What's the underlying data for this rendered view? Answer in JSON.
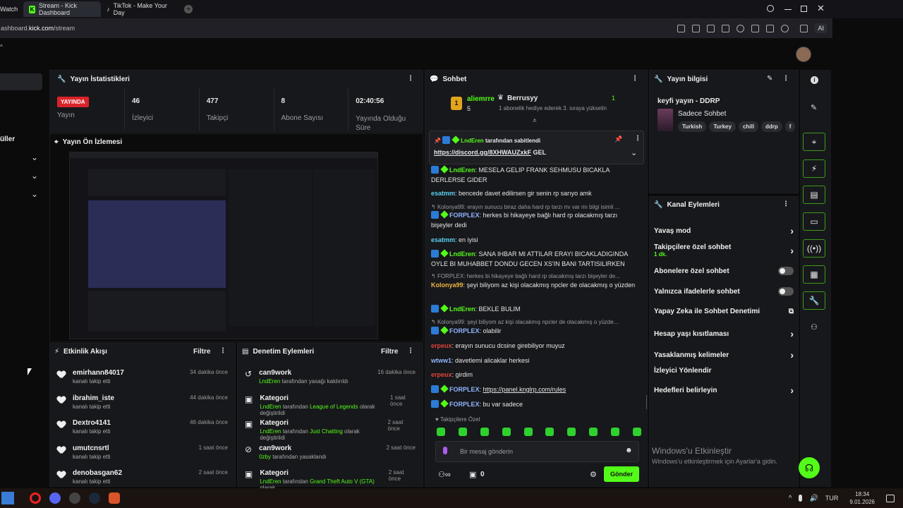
{
  "browser": {
    "tabs": [
      {
        "label": "Watch"
      },
      {
        "label": "Stream - Kick Dashboard",
        "active": true
      },
      {
        "label": "TikTok - Make Your Day"
      }
    ],
    "url_prefix": "ashboard.",
    "url_domain": "kick.com",
    "url_path": "/stream",
    "ai_label": "AI"
  },
  "left_menu": {
    "partial_label": "üller",
    "chevrons": [
      "chevron-down-icon",
      "chevron-down-icon",
      "chevron-down-icon"
    ]
  },
  "stats": {
    "title": "Yayın İstatistikleri",
    "live_badge": "YAYINDA",
    "live_label": "Yayın",
    "viewers": {
      "value": "46",
      "label": "İzleyici"
    },
    "followers": {
      "value": "477",
      "label": "Takipçi"
    },
    "subs": {
      "value": "8",
      "label": "Abone Sayısı"
    },
    "duration": {
      "value": "02:40:56",
      "label": "Yayında Olduğu Süre"
    }
  },
  "preview": {
    "title": "Yayın Ön İzlemesi"
  },
  "activity": {
    "title": "Etkinlik Akışı",
    "filter": "Filtre",
    "items": [
      {
        "name": "emirhann84017",
        "sub": "kanalı takip etti",
        "time": "34 dakika önce"
      },
      {
        "name": "ibrahim_iste",
        "sub": "kanalı takip etti",
        "time": "44 dakika önce"
      },
      {
        "name": "Dextro4141",
        "sub": "kanalı takip etti",
        "time": "46 dakika önce"
      },
      {
        "name": "umutcnsrtl",
        "sub": "kanalı takip etti",
        "time": "1 saat önce"
      },
      {
        "name": "denobasgan62",
        "sub": "kanalı takip etti",
        "time": "2 saat önce"
      }
    ]
  },
  "moderation": {
    "title": "Denetim Eylemleri",
    "filter": "Filtre",
    "items": [
      {
        "name": "can9work",
        "actor": "LndEren",
        "text": " tarafından yasağı kaldırıldı",
        "time": "16 dakika önce"
      },
      {
        "name": "Kategori",
        "actor": "LndEren",
        "text": " tarafından ",
        "cat": "League of Legends",
        "tail": " olarak değiştirildi",
        "time": "1 saat önce"
      },
      {
        "name": "Kategori",
        "actor": "LndEren",
        "text": " tarafından ",
        "cat": "Just Chatting",
        "tail": " olarak değiştirildi",
        "time": "2 saat önce"
      },
      {
        "name": "can9work",
        "actor": "0zby",
        "text": " tarafından yasaklandı",
        "time": "2 saat önce"
      },
      {
        "name": "Kategori",
        "actor": "LndEren",
        "text": " tarafından ",
        "cat": "Grand Theft Auto V (GTA)",
        "tail": " olarak",
        "time": "2 saat önce"
      }
    ]
  },
  "chat": {
    "title": "Sohbet",
    "top_user": "aliemrre",
    "top_rank": "1",
    "top_count": "5",
    "gifter": "Berrusyy",
    "gifter_count": "1",
    "gift_text": "1 abonelik hediye ederek 3. sıraya yükselin",
    "pinned_by": "LndEren",
    "pinned_label": " tarafından sabitlendi",
    "pinned_link": "https://discord.gg/8XHWAUZxkF",
    "pinned_tail": " GEL",
    "messages": [
      {
        "user": "LndEren",
        "text": ": MESELA GELIP FRANK SEHMUSU BICAKLA DERLERSE GIDER"
      },
      {
        "user": "esatmm",
        "text": ": bencede davet edilirsen gir senin rp sarıyo amk"
      },
      {
        "reply": "Kolonya99: erayın sunucu biraz daha hard rp tarzı mı var mı bilgi isimli ..."
      },
      {
        "user": "FORPLEX",
        "text": ": herkes bi hikayeye bağlı hard rp olacakmış tarzı bişeyler dedi"
      },
      {
        "user": "esatmm",
        "text": ": en iyisi"
      },
      {
        "user": "LndEren",
        "text": ": SANA IHBAR MI ATTILAR ERAYI BICAKLADIGINDA OYLE BI MUHABBET DONDU GECEN XS'IN BANI TARTISILIRKEN"
      },
      {
        "reply": "FORPLEX: herkes bi hikayeye bağlı hard rp olacakmış tarzı bişeyler de..."
      },
      {
        "user": "Kolonya99",
        "text": ": şeyi biliyom az kişi olacakmış npcler de olacakmış o yüzden"
      },
      {
        "user": "LndEren",
        "text": ": BEKLE BULIM"
      },
      {
        "reply": "Kolonya99: şeyi biliyom az kişi olacakmış npcler de olacakmış o yüzde..."
      },
      {
        "user": "FORPLEX",
        "text": ": olabilir"
      },
      {
        "user": "erpeux",
        "text": ": erayın sunucu dcsine girebiliyor muyuz"
      },
      {
        "user": "wtww1",
        "text": ": davetlemi alicaklar herkesi"
      },
      {
        "user": "erpeux",
        "text": ": girdim"
      },
      {
        "user": "FORPLEX",
        "text": ": ",
        "link": "https://panel.knglrp.com/rules"
      },
      {
        "user": "FORPLEX",
        "text": ": bu var sadece"
      }
    ],
    "followers_only": "Takipçilere Özel",
    "input_placeholder": "Bir mesaj gönderin",
    "footer_count": "0",
    "send_label": "Gönder"
  },
  "stream_info": {
    "title": "Yayın bilgisi",
    "stream_title": "keyfi yayın - DDRP",
    "category": "Sadece Sohbet",
    "tags": [
      "Turkish",
      "Turkey",
      "chill",
      "ddrp",
      "f"
    ]
  },
  "channel_actions": {
    "title": "Kanal Eylemleri",
    "items": [
      {
        "label": "Yavaş mod",
        "control": "chevron"
      },
      {
        "label": "Takipçilere özel sohbet",
        "sub": "1 dk.",
        "control": "chevron"
      },
      {
        "label": "Abonelere özel sohbet",
        "control": "toggle"
      },
      {
        "label": "Yalnızca ifadelerle sohbet",
        "control": "toggle"
      },
      {
        "label": "Yapay Zeka ile Sohbet Denetimi",
        "control": "external"
      },
      {
        "label": "Hesap yaşı kısıtlaması",
        "control": "chevron"
      },
      {
        "label": "Yasaklanmış kelimeler",
        "control": "chevron"
      },
      {
        "label": "İzleyici Yönlendir",
        "control": "none"
      },
      {
        "label": "Hedefleri belirleyin",
        "control": "chevron"
      }
    ]
  },
  "watermark": {
    "title": "Windows'u Etkinleştir",
    "sub": "Windows'u etkinleştirmek için Ayarlar'a gidin."
  },
  "taskbar": {
    "lang": "TUR",
    "time": "18:34",
    "date": "9.01.2026"
  },
  "colors": {
    "accent": "#53fc18",
    "live": "#d9232a",
    "panel": "#17181b"
  }
}
